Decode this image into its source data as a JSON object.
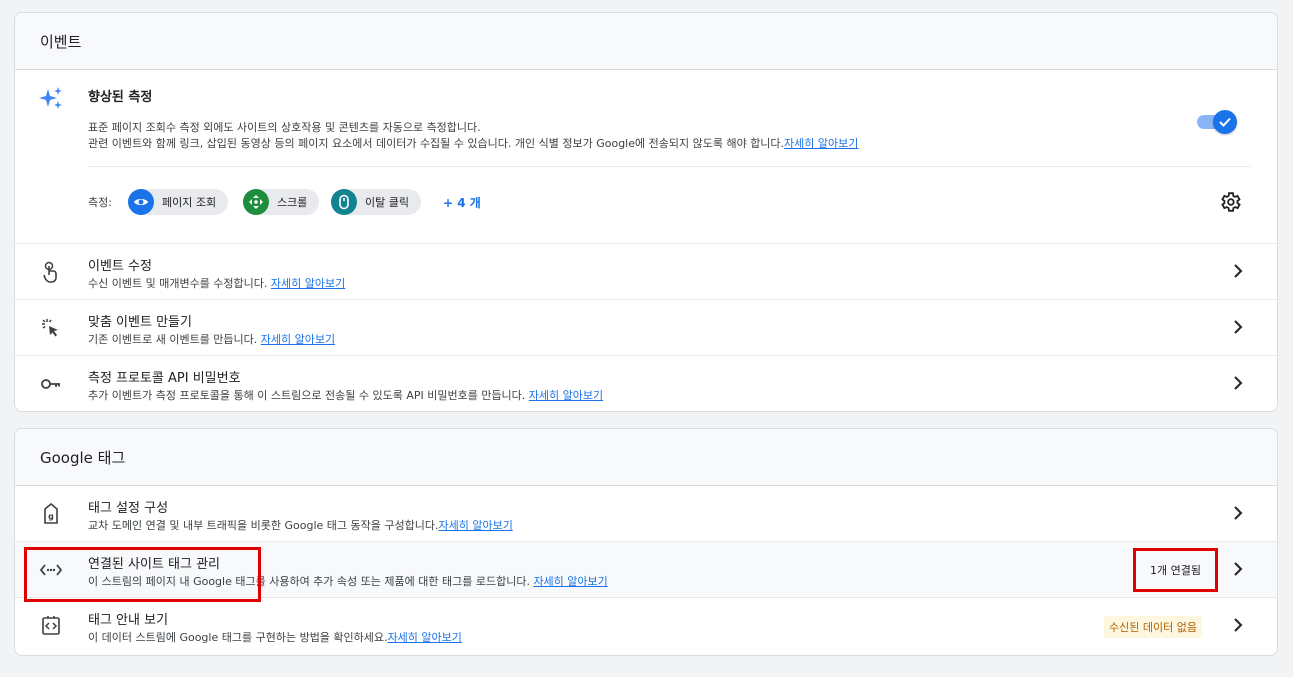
{
  "events_section": {
    "header": "이벤트",
    "enhanced": {
      "title": "향상된 측정",
      "desc_line1": "표준 페이지 조회수 측정 외에도 사이트의 상호작용 및 콘텐츠를 자동으로 측정합니다.",
      "desc_line2": "관련 이벤트와 함께 링크, 삽입된 동영상 등의 페이지 요소에서 데이터가 수집될 수 있습니다. 개인 식별 정보가 Google에 전송되지 않도록 해야 합니다.",
      "learn_more": "자세히 알아보기",
      "toggle_on": true,
      "measure_label": "측정:",
      "chips": [
        {
          "label": "페이지 조회",
          "icon": "eye-icon",
          "color": "#1a73e8"
        },
        {
          "label": "스크롤",
          "icon": "scroll-crosshair-icon",
          "color": "#1e8e3e"
        },
        {
          "label": "이탈 클릭",
          "icon": "mouse-icon",
          "color": "#12838f"
        }
      ],
      "more_label": "+ 4 개"
    },
    "rows": [
      {
        "title": "이벤트 수정",
        "desc": "수신 이벤트 및 매개변수를 수정합니다. ",
        "link": "자세히 알아보기",
        "icon": "touch-hand-icon"
      },
      {
        "title": "맞춤 이벤트 만들기",
        "desc": "기존 이벤트로 새 이벤트를 만듭니다. ",
        "link": "자세히 알아보기",
        "icon": "click-sparkle-icon"
      },
      {
        "title": "측정 프로토콜 API 비밀번호",
        "desc": "추가 이벤트가 측정 프로토콜을 통해 이 스트림으로 전송될 수 있도록 API 비밀번호를 만듭니다. ",
        "link": "자세히 알아보기",
        "icon": "key-icon"
      }
    ]
  },
  "tag_section": {
    "header": "Google 태그",
    "rows": [
      {
        "title": "태그 설정 구성",
        "desc": "교차 도메인 연결 및 내부 트래픽을 비롯한 Google 태그 동작을 구성합니다.",
        "link": "자세히 알아보기",
        "icon": "tag-icon"
      },
      {
        "title": "연결된 사이트 태그 관리",
        "desc": "이 스트림의 페이지 내 Google 태그를 사용하여 추가 속성 또는 제품에 대한 태그를 로드합니다. ",
        "link": "자세히 알아보기",
        "icon": "code-icon",
        "badge": "1개 연결됨"
      },
      {
        "title": "태그 안내 보기",
        "desc": "이 데이터 스트림에 Google 태그를 구현하는 방법을 확인하세요.",
        "link": "자세히 알아보기",
        "icon": "code-box-icon",
        "badge": "수신된 데이터 없음"
      }
    ]
  }
}
